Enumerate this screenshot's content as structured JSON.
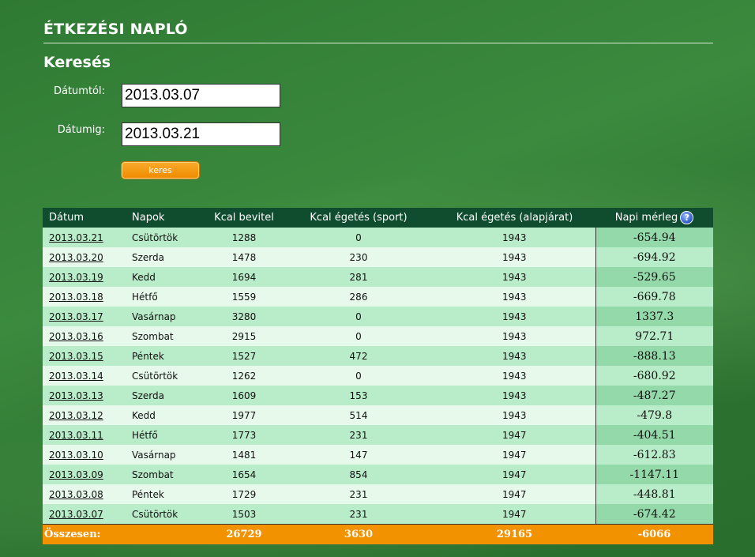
{
  "page": {
    "title": "ÉTKEZÉSI NAPLÓ",
    "search_title": "Keresés"
  },
  "search": {
    "from_label": "Dátumtól:",
    "from_value": "2013.03.07",
    "to_label": "Dátumig:",
    "to_value": "2013.03.21",
    "button_label": "keres"
  },
  "table": {
    "headers": {
      "date": "Dátum",
      "day": "Napok",
      "intake": "Kcal bevitel",
      "sport": "Kcal égetés (sport)",
      "base": "Kcal égetés (alapjárat)",
      "balance": "Napi mérleg",
      "help_icon": "?"
    },
    "rows": [
      {
        "date": "2013.03.21",
        "day": "Csütörtök",
        "intake": "1288",
        "sport": "0",
        "base": "1943",
        "balance": "-654.94"
      },
      {
        "date": "2013.03.20",
        "day": "Szerda",
        "intake": "1478",
        "sport": "230",
        "base": "1943",
        "balance": "-694.92"
      },
      {
        "date": "2013.03.19",
        "day": "Kedd",
        "intake": "1694",
        "sport": "281",
        "base": "1943",
        "balance": "-529.65"
      },
      {
        "date": "2013.03.18",
        "day": "Hétfő",
        "intake": "1559",
        "sport": "286",
        "base": "1943",
        "balance": "-669.78"
      },
      {
        "date": "2013.03.17",
        "day": "Vasárnap",
        "intake": "3280",
        "sport": "0",
        "base": "1943",
        "balance": "1337.3"
      },
      {
        "date": "2013.03.16",
        "day": "Szombat",
        "intake": "2915",
        "sport": "0",
        "base": "1943",
        "balance": "972.71"
      },
      {
        "date": "2013.03.15",
        "day": "Péntek",
        "intake": "1527",
        "sport": "472",
        "base": "1943",
        "balance": "-888.13"
      },
      {
        "date": "2013.03.14",
        "day": "Csütörtök",
        "intake": "1262",
        "sport": "0",
        "base": "1943",
        "balance": "-680.92"
      },
      {
        "date": "2013.03.13",
        "day": "Szerda",
        "intake": "1609",
        "sport": "153",
        "base": "1943",
        "balance": "-487.27"
      },
      {
        "date": "2013.03.12",
        "day": "Kedd",
        "intake": "1977",
        "sport": "514",
        "base": "1943",
        "balance": "-479.8"
      },
      {
        "date": "2013.03.11",
        "day": "Hétfő",
        "intake": "1773",
        "sport": "231",
        "base": "1947",
        "balance": "-404.51"
      },
      {
        "date": "2013.03.10",
        "day": "Vasárnap",
        "intake": "1481",
        "sport": "147",
        "base": "1947",
        "balance": "-612.83"
      },
      {
        "date": "2013.03.09",
        "day": "Szombat",
        "intake": "1654",
        "sport": "854",
        "base": "1947",
        "balance": "-1147.11"
      },
      {
        "date": "2013.03.08",
        "day": "Péntek",
        "intake": "1729",
        "sport": "231",
        "base": "1947",
        "balance": "-448.81"
      },
      {
        "date": "2013.03.07",
        "day": "Csütörtök",
        "intake": "1503",
        "sport": "231",
        "base": "1947",
        "balance": "-674.42"
      }
    ],
    "totals": {
      "label": "Összesen:",
      "intake": "26729",
      "sport": "3630",
      "base": "29165",
      "balance": "-6066"
    }
  },
  "colors": {
    "background": "#2f7a33",
    "table_header": "#0f4d2e",
    "row_light": "#e6f9ea",
    "row_dark": "#b9ecc8",
    "totals_bar": "#f39200",
    "button": "#f08c00"
  }
}
